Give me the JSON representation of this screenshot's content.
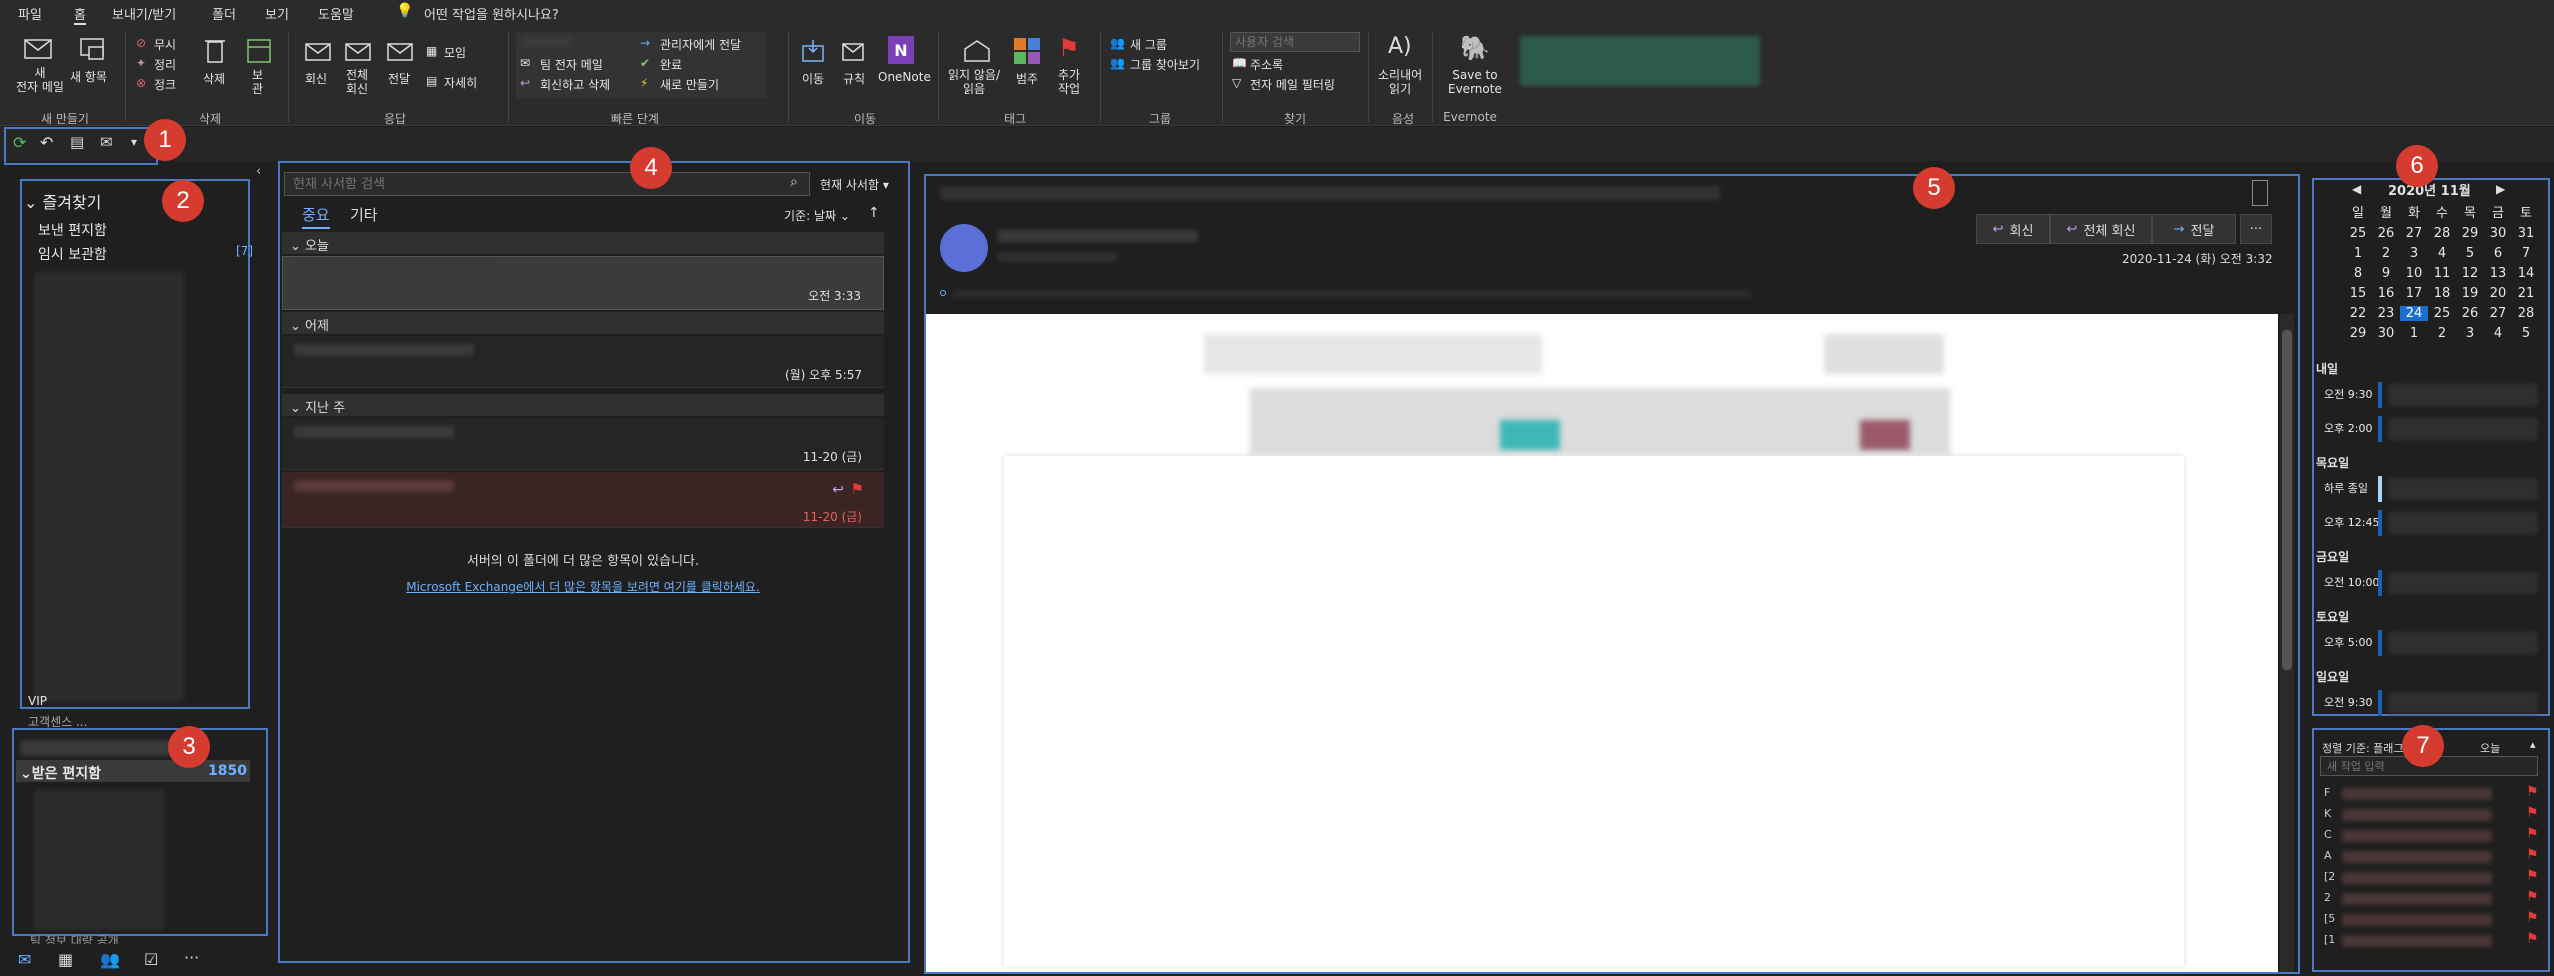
{
  "menu": [
    "파일",
    "홈",
    "보내기/받기",
    "폴더",
    "보기",
    "도움말"
  ],
  "tellme": "어떤 작업을 원하시나요?",
  "ribbon": {
    "new_email": "새\n전자 메일",
    "new_items": "새 항목",
    "group_new": "새 만들기",
    "ignore": "무시",
    "cleanup": "정리",
    "junk": "정크",
    "delete": "삭제",
    "archive": "보\n관",
    "group_delete": "삭제",
    "reply": "회신",
    "reply_all": "전체\n회신",
    "forward": "전달",
    "meeting": "모임",
    "more": "자세히",
    "group_respond": "응답",
    "qs": [
      "팀 전자 메일",
      "회신하고 삭제",
      "관리자에게 전달",
      "완료",
      "새로 만들기"
    ],
    "group_qs": "빠른 단계",
    "move": "이동",
    "rules": "규칙",
    "onenote": "OneNote",
    "group_move": "이동",
    "unread": "읽지 않음/\n읽음",
    "categorize": "범주",
    "followup": "추가\n작업",
    "group_tags": "태그",
    "new_group": "새 그룹",
    "browse_groups": "그룹 찾아보기",
    "group_groups": "그룹",
    "search_people": "사용자 검색",
    "address_book": "주소록",
    "filter_email": "전자 메일 필터링",
    "group_find": "찾기",
    "read_aloud": "소리내어\n읽기",
    "group_speech": "음성",
    "evernote": "Save to\nEvernote",
    "group_evernote": "Evernote"
  },
  "nav": {
    "favorites": "즐겨찾기",
    "sent": "보낸 편지함",
    "drafts": "임시 보관함",
    "drafts_count": "[7]",
    "vip": "VIP",
    "mailbox": "고객센스 ...",
    "inbox": "받은 편지함",
    "inbox_count": "1850",
    "bottom": "팀 정보 대량 공개"
  },
  "list": {
    "search_placeholder": "현재 사서함 검색",
    "scope": "현재 사서함",
    "tab_focused": "중요",
    "tab_other": "기타",
    "sort": "기준: 날짜",
    "groups": [
      "오늘",
      "어제",
      "지난 주"
    ],
    "times": [
      "오전 3:33",
      "(월) 오후 5:57",
      "11-20 (금)",
      "11-20 (금)"
    ],
    "more_server": "서버의 이 폴더에 더 많은 항목이 있습니다.",
    "more_link": "Microsoft Exchange에서 더 많은 항목을 보려면 여기를 클릭하세요."
  },
  "reading": {
    "reply": "회신",
    "reply_all": "전체 회신",
    "forward": "전달",
    "date": "2020-11-24 (화) 오전 3:32",
    "more": "···"
  },
  "calendar": {
    "month": "2020년 11월",
    "weekdays": [
      "일",
      "월",
      "화",
      "수",
      "목",
      "금",
      "토"
    ],
    "weeks": [
      [
        "25",
        "26",
        "27",
        "28",
        "29",
        "30",
        "31"
      ],
      [
        "1",
        "2",
        "3",
        "4",
        "5",
        "6",
        "7"
      ],
      [
        "8",
        "9",
        "10",
        "11",
        "12",
        "13",
        "14"
      ],
      [
        "15",
        "16",
        "17",
        "18",
        "19",
        "20",
        "21"
      ],
      [
        "22",
        "23",
        "24",
        "25",
        "26",
        "27",
        "28"
      ],
      [
        "29",
        "30",
        "1",
        "2",
        "3",
        "4",
        "5"
      ]
    ],
    "today": "24"
  },
  "agenda": [
    {
      "day": "내일",
      "items": [
        "오전 9:30",
        "오후 2:00"
      ]
    },
    {
      "day": "목요일",
      "items": [
        "하루 종일",
        "오후 12:45"
      ]
    },
    {
      "day": "금요일",
      "items": [
        "오전 10:00"
      ]
    },
    {
      "day": "토요일",
      "items": [
        "오후 5:00"
      ]
    },
    {
      "day": "일요일",
      "items": [
        "오전 9:30"
      ]
    }
  ],
  "tasks": {
    "sort": "정렬 기준: 플래그",
    "today": "오늘",
    "placeholder": "새 작업 입력",
    "letters": [
      "F",
      "K",
      "C",
      "A",
      "[2",
      "2",
      "[5",
      "[1"
    ]
  },
  "badges": [
    "1",
    "2",
    "3",
    "4",
    "5",
    "6",
    "7"
  ]
}
